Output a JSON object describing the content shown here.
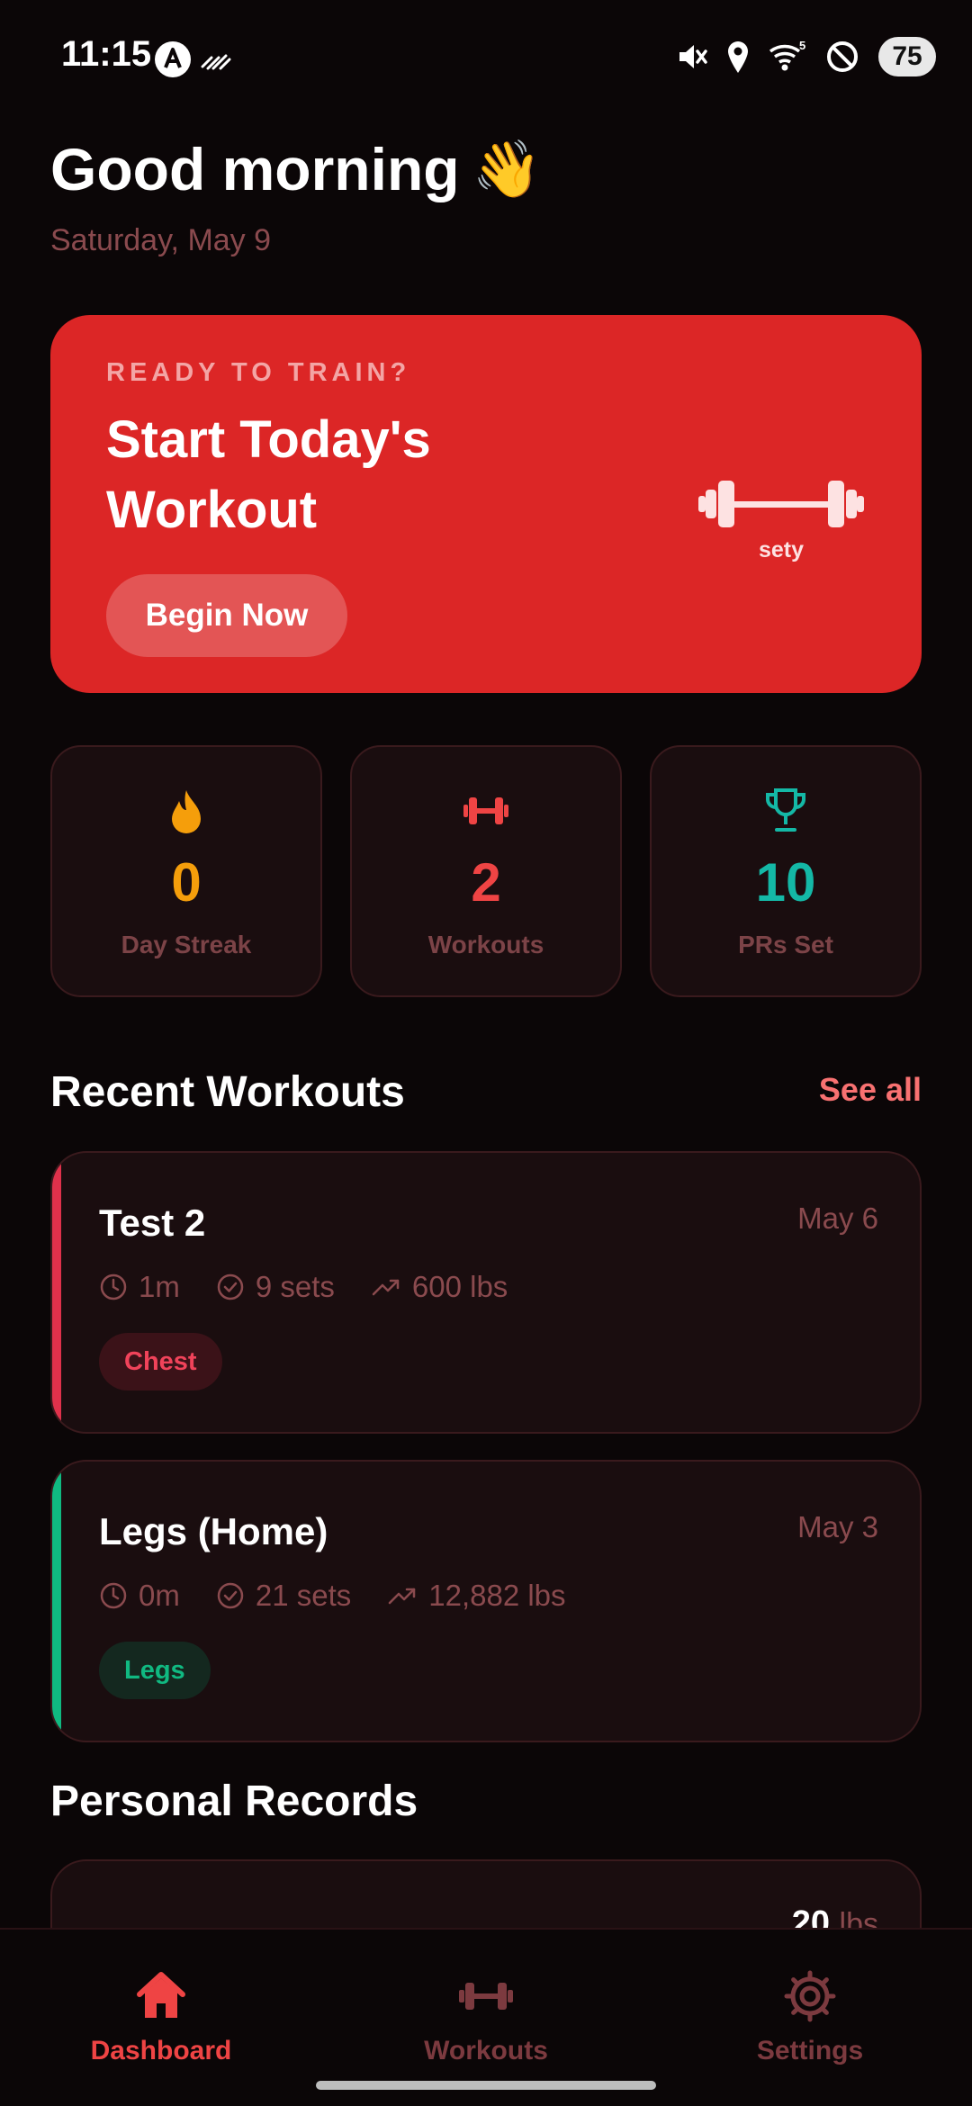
{
  "status_bar": {
    "time": "11:15",
    "battery": "75",
    "icons": [
      "android-notification-icon",
      "data-activity-icon",
      "mute-icon",
      "location-icon",
      "wifi-icon",
      "do-not-disturb-icon",
      "battery-icon"
    ]
  },
  "header": {
    "greeting": "Good morning",
    "greeting_emoji": "👋",
    "date": "Saturday, May 9"
  },
  "hero": {
    "kicker": "READY TO TRAIN?",
    "title": "Start Today's Workout",
    "button_label": "Begin Now",
    "logo_text": "sety",
    "icon": "barbell-icon"
  },
  "stats": [
    {
      "value": "0",
      "label": "Day Streak",
      "icon": "flame-icon",
      "color": "#f59e0b"
    },
    {
      "value": "2",
      "label": "Workouts",
      "icon": "dumbbell-icon",
      "color": "#ef4444"
    },
    {
      "value": "10",
      "label": "PRs Set",
      "icon": "trophy-icon",
      "color": "#14b8a6"
    }
  ],
  "recent": {
    "title": "Recent Workouts",
    "see_all": "See all",
    "workouts": [
      {
        "name": "Test 2",
        "date": "May 6",
        "duration": "1m",
        "sets": "9 sets",
        "volume": "600 lbs",
        "tag": "Chest",
        "accent": "#e0314b"
      },
      {
        "name": "Legs (Home)",
        "date": "May 3",
        "duration": "0m",
        "sets": "21 sets",
        "volume": "12,882 lbs",
        "tag": "Legs",
        "accent": "#10b981"
      }
    ]
  },
  "records": {
    "title": "Personal Records",
    "first_value": "20",
    "first_unit": "lbs"
  },
  "nav": {
    "items": [
      {
        "label": "Dashboard",
        "icon": "home-icon",
        "active": true
      },
      {
        "label": "Workouts",
        "icon": "dumbbell-icon",
        "active": false
      },
      {
        "label": "Settings",
        "icon": "gear-icon",
        "active": false
      }
    ]
  },
  "colors": {
    "background": "#0b0607",
    "card": "#1a0d0f",
    "accent": "#dc2626",
    "muted_text": "#8a4a4e"
  }
}
